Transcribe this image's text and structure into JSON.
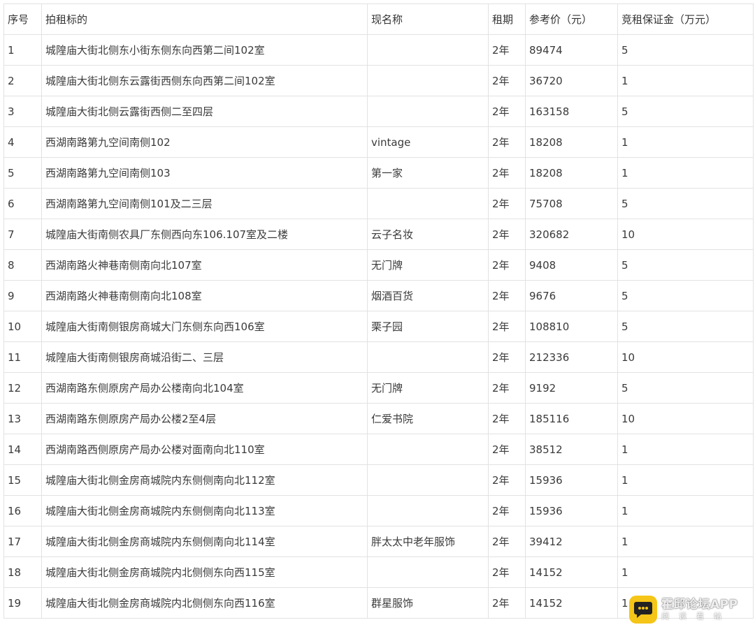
{
  "table": {
    "headers": [
      "序号",
      "拍租标的",
      "现名称",
      "租期",
      "参考价（元）",
      "竞租保证金（万元）"
    ],
    "rows": [
      [
        "1",
        "城隍庙大街北侧东小街东侧东向西第二间102室",
        "",
        "2年",
        "89474",
        "5"
      ],
      [
        "2",
        "城隍庙大街北侧东云露街西侧东向西第二间102室",
        "",
        "2年",
        "36720",
        "1"
      ],
      [
        "3",
        "城隍庙大街北侧云露街西侧二至四层",
        "",
        "2年",
        "163158",
        "5"
      ],
      [
        "4",
        "西湖南路第九空间南侧102",
        "vintage",
        "2年",
        "18208",
        "1"
      ],
      [
        "5",
        "西湖南路第九空间南侧103",
        "第一家",
        "2年",
        "18208",
        "1"
      ],
      [
        "6",
        "西湖南路第九空间南侧101及二三层",
        "",
        "2年",
        "75708",
        "5"
      ],
      [
        "7",
        "城隍庙大街南侧农具厂东侧西向东106.107室及二楼",
        "云子名妆",
        "2年",
        "320682",
        "10"
      ],
      [
        "8",
        "西湖南路火神巷南侧南向北107室",
        "无门牌",
        "2年",
        "9408",
        "5"
      ],
      [
        "9",
        "西湖南路火神巷南侧南向北108室",
        "烟酒百货",
        "2年",
        "9676",
        "5"
      ],
      [
        "10",
        "城隍庙大街南侧银房商城大门东侧东向西106室",
        "栗子园",
        "2年",
        "108810",
        "5"
      ],
      [
        "11",
        "城隍庙大街南侧银房商城沿街二、三层",
        "",
        "2年",
        "212336",
        "10"
      ],
      [
        "12",
        "西湖南路东侧原房产局办公楼南向北104室",
        "无门牌",
        "2年",
        "9192",
        "5"
      ],
      [
        "13",
        "西湖南路东侧原房产局办公楼2至4层",
        "仁爱书院",
        "2年",
        "185116",
        "10"
      ],
      [
        "14",
        "西湖南路西侧原房产局办公楼对面南向北110室",
        "",
        "2年",
        "38512",
        "1"
      ],
      [
        "15",
        "城隍庙大街北侧金房商城院内东侧侧南向北112室",
        "",
        "2年",
        "15936",
        "1"
      ],
      [
        "16",
        "城隍庙大街北侧金房商城院内东侧侧南向北113室",
        "",
        "2年",
        "15936",
        "1"
      ],
      [
        "17",
        "城隍庙大街北侧金房商城院内东侧侧南向北114室",
        "胖太太中老年服饰",
        "2年",
        "39412",
        "1"
      ],
      [
        "18",
        "城隍庙大街北侧金房商城院内北侧侧东向西115室",
        "",
        "2年",
        "14152",
        "1"
      ],
      [
        "19",
        "城隍庙大街北侧金房商城院内北侧侧东向西116室",
        "群星服饰",
        "2年",
        "14152",
        "1"
      ]
    ]
  },
  "watermark": {
    "title": "霍邱论坛APP",
    "subtitle": "阅读看帖",
    "icon": "chat-bubble-icon",
    "brand_color": "#f5c518"
  }
}
